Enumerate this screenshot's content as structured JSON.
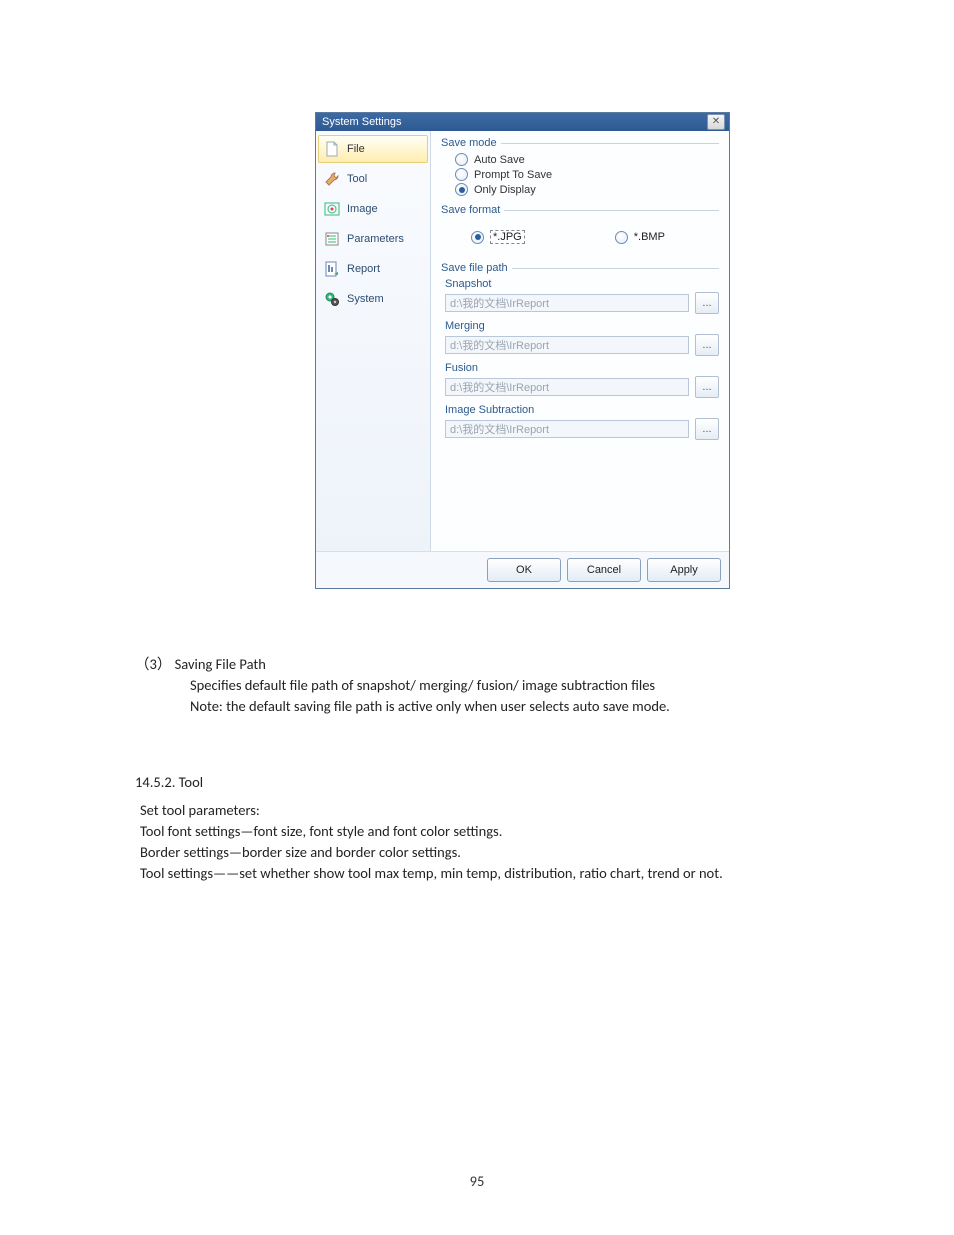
{
  "dialog": {
    "title": "System Settings",
    "close_glyph": "✕",
    "sidebar": {
      "items": [
        {
          "label": "File",
          "icon": "file-icon"
        },
        {
          "label": "Tool",
          "icon": "tool-icon"
        },
        {
          "label": "Image",
          "icon": "image-icon"
        },
        {
          "label": "Parameters",
          "icon": "parameters-icon"
        },
        {
          "label": "Report",
          "icon": "report-icon"
        },
        {
          "label": "System",
          "icon": "system-icon"
        }
      ]
    },
    "groups": {
      "save_mode": {
        "title": "Save mode",
        "options": {
          "auto": "Auto Save",
          "prompt": "Prompt To Save",
          "only": "Only Display"
        }
      },
      "save_format": {
        "title": "Save format",
        "jpg": "*.JPG",
        "bmp": "*.BMP"
      },
      "save_path": {
        "title": "Save file path",
        "snapshot_label": "Snapshot",
        "snapshot_value": "d:\\我的文档\\IrReport",
        "merging_label": "Merging",
        "merging_value": "d:\\我的文档\\IrReport",
        "fusion_label": "Fusion",
        "fusion_value": "d:\\我的文档\\IrReport",
        "imgsub_label": "Image Subtraction",
        "imgsub_value": "d:\\我的文档\\IrReport",
        "browse": "..."
      }
    },
    "buttons": {
      "ok": "OK",
      "cancel": "Cancel",
      "apply": "Apply"
    }
  },
  "doc": {
    "item3_num": "（3）",
    "item3_title": "Saving File Path",
    "item3_line1": "Specifies default file path of snapshot/ merging/ fusion/ image subtraction files",
    "item3_line2": "Note: the default saving file path is active only when user selects auto save mode.",
    "heading_1452": "14.5.2. Tool",
    "tool_intro": "Set tool parameters:",
    "tool_l1": "Tool font settings—font size, font style and font color settings.",
    "tool_l2": "Border settings—border size and border color settings.",
    "tool_l3": "Tool settings——set whether show tool max temp, min temp, distribution, ratio chart, trend or not.",
    "page_no": "95"
  }
}
